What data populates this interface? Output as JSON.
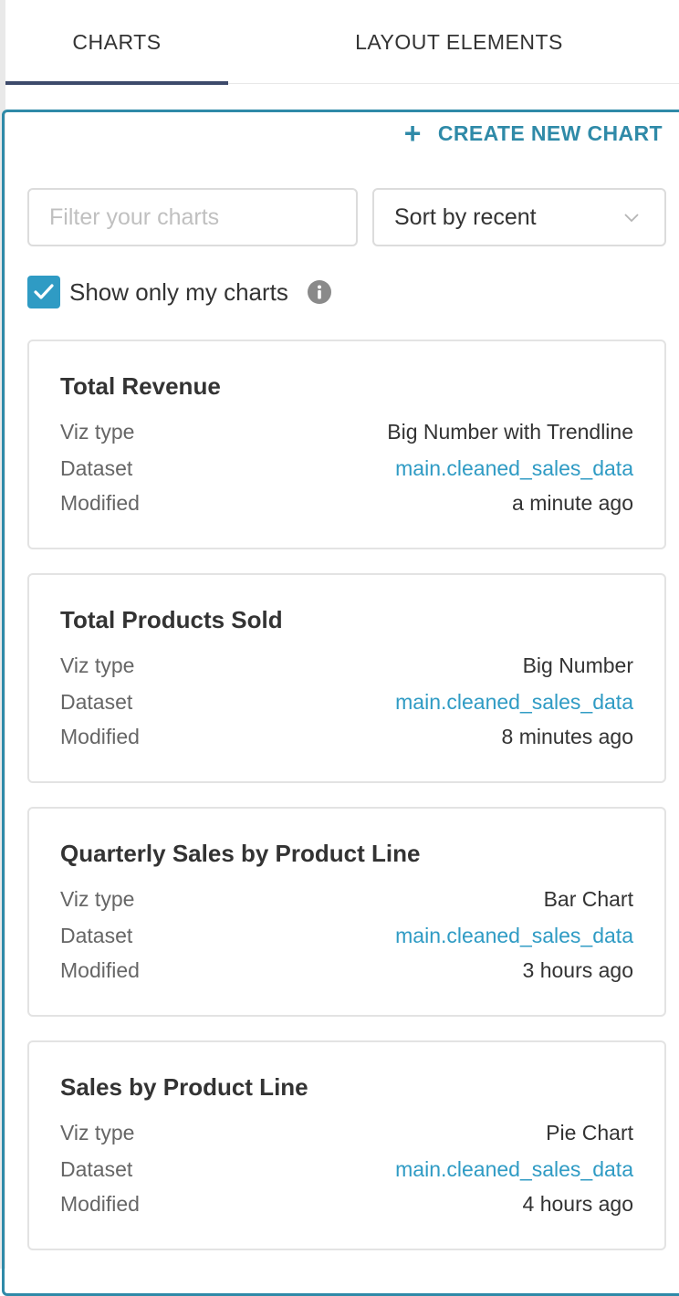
{
  "tabs": {
    "charts": "CHARTS",
    "layout_elements": "LAYOUT ELEMENTS"
  },
  "toolbar": {
    "create_icon": "plus-icon",
    "create_label": "CREATE NEW CHART",
    "filter_placeholder": "Filter your charts",
    "filter_value": "",
    "sort_value": "Sort by recent",
    "show_mine_label": "Show only my charts",
    "show_mine_checked": true
  },
  "field_labels": {
    "viz_type": "Viz type",
    "dataset": "Dataset",
    "modified": "Modified"
  },
  "charts": [
    {
      "title": "Total Revenue",
      "viz_type": "Big Number with Trendline",
      "dataset": "main.cleaned_sales_data",
      "modified": "a minute ago"
    },
    {
      "title": "Total Products Sold",
      "viz_type": "Big Number",
      "dataset": "main.cleaned_sales_data",
      "modified": "8 minutes ago"
    },
    {
      "title": "Quarterly Sales by Product Line",
      "viz_type": "Bar Chart",
      "dataset": "main.cleaned_sales_data",
      "modified": "3 hours ago"
    },
    {
      "title": "Sales by Product Line",
      "viz_type": "Pie Chart",
      "dataset": "main.cleaned_sales_data",
      "modified": "4 hours ago"
    }
  ],
  "colors": {
    "accent": "#2f8aa8",
    "link": "#2f9bc4",
    "tab_underline": "#3d4a6b",
    "checkbox": "#2f9bc4"
  }
}
